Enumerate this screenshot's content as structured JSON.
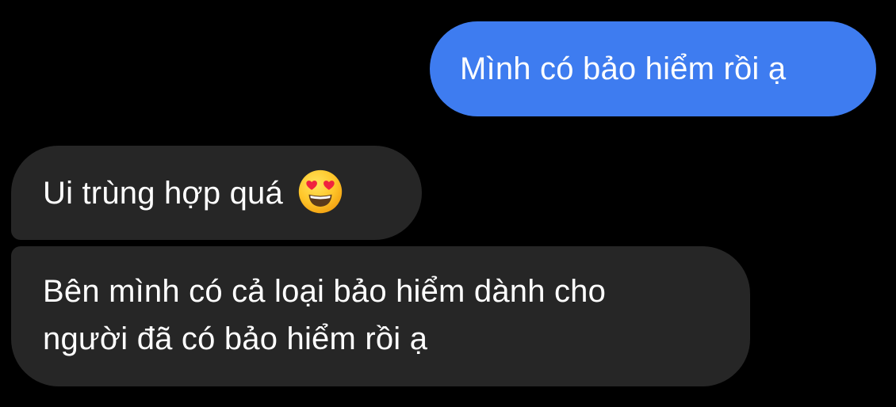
{
  "conversation": {
    "messages": [
      {
        "direction": "outgoing",
        "text": "Mình có bảo hiểm rồi ạ"
      },
      {
        "direction": "incoming",
        "text": "Ui trùng hợp quá",
        "emoji": "heart-eyes-emoji-icon"
      },
      {
        "direction": "incoming",
        "lines": [
          "Bên mình có cả loại bảo hiểm dành cho",
          "người đã có bảo hiểm rồi ạ"
        ]
      }
    ]
  },
  "colors": {
    "background": "#000000",
    "outgoing_bubble": "#3e7cf0",
    "incoming_bubble": "#262626",
    "message_text": "#ffffff"
  }
}
